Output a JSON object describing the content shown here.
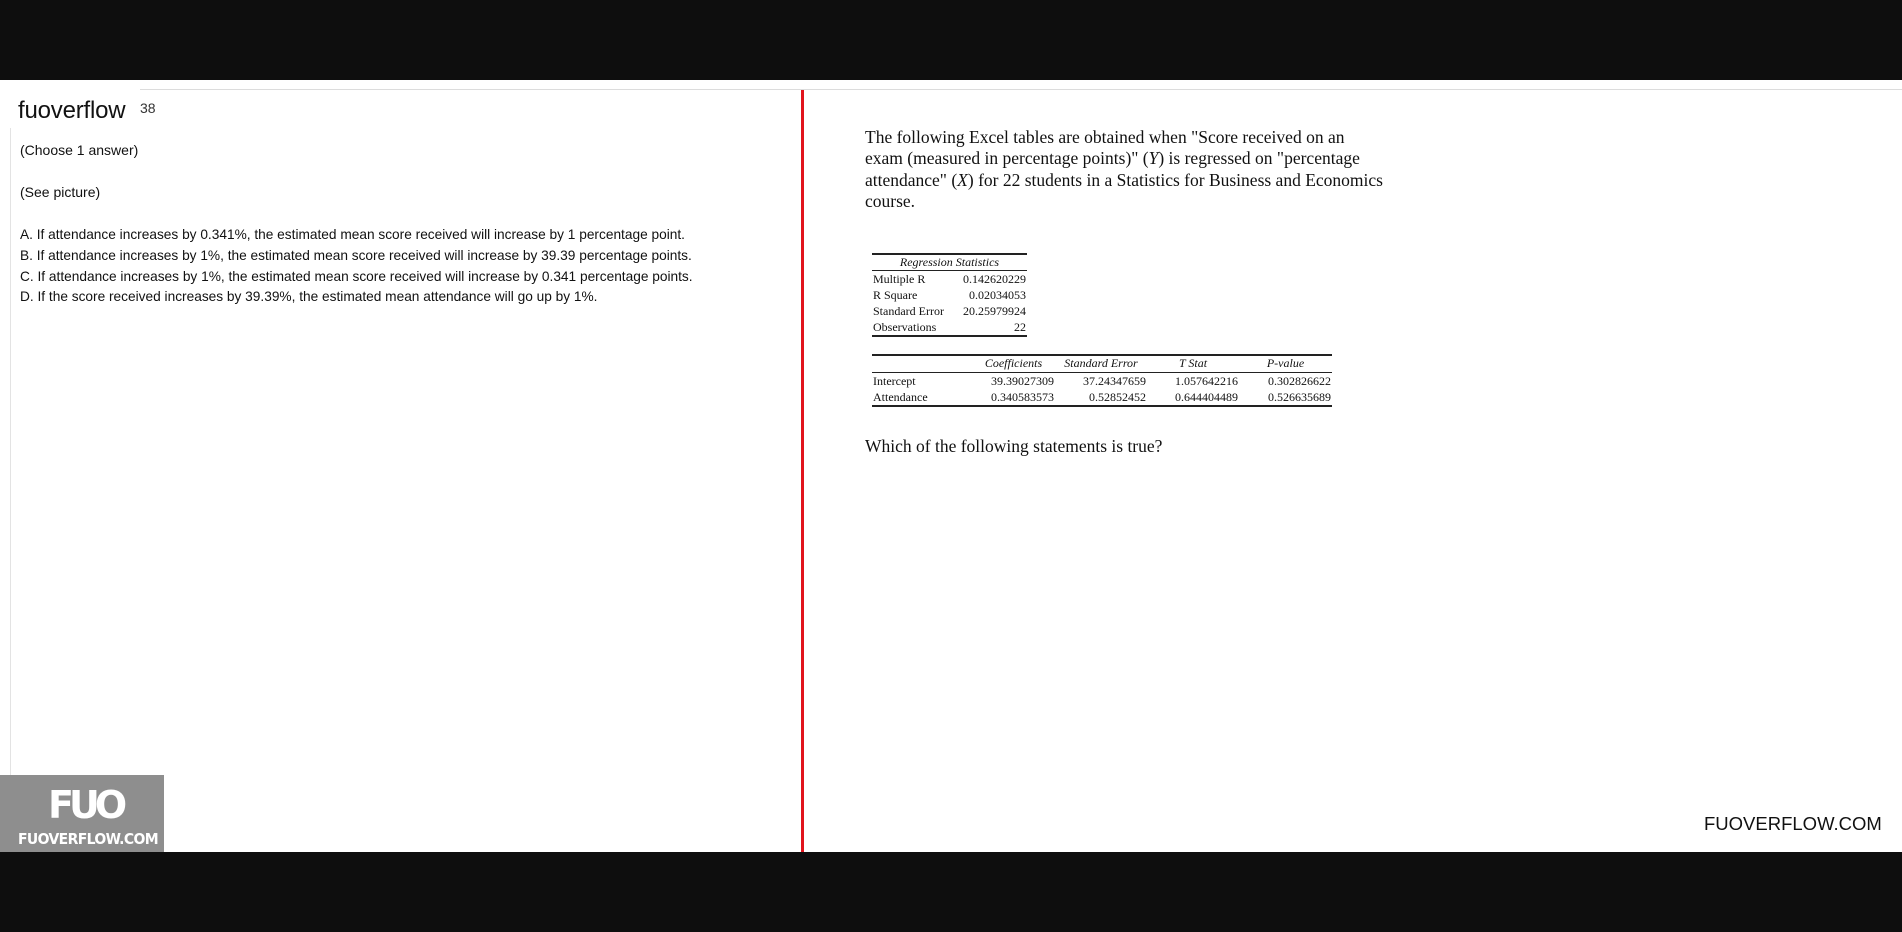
{
  "brand": {
    "name": "fuoverflow",
    "suffix": "38"
  },
  "question": {
    "instruction": "(Choose 1 answer)",
    "see_picture": "(See picture)",
    "options": [
      "A. If attendance increases by 0.341%, the estimated mean score received will increase by 1 percentage point.",
      "B. If attendance increases by 1%, the estimated mean score received will increase by 39.39 percentage points.",
      "C. If attendance increases by 1%, the estimated mean score received will increase by 0.341 percentage points.",
      "D. If the score received increases by 39.39%, the estimated mean attendance will go up by 1%."
    ]
  },
  "watermark": {
    "logo": "FUO",
    "text": "FUOVERFLOW.COM"
  },
  "picture": {
    "intro": {
      "p1": "The following Excel tables are obtained when \"Score received on an exam (measured in percentage points)\" (",
      "y_var": "Y",
      "p2": ") is regressed on \"percentage attendance\" (",
      "x_var": "X",
      "p3": ") for 22 students in a Statistics for Business and Economics course."
    },
    "regression_statistics": {
      "header": "Regression Statistics",
      "rows": [
        {
          "label": "Multiple R",
          "value": "0.142620229"
        },
        {
          "label": "R Square",
          "value": "0.02034053"
        },
        {
          "label": "Standard Error",
          "value": "20.25979924"
        },
        {
          "label": "Observations",
          "value": "22"
        }
      ]
    },
    "coefficients_table": {
      "headers": [
        "",
        "Coefficients",
        "Standard Error",
        "T Stat",
        "P-value"
      ],
      "rows": [
        {
          "label": "Intercept",
          "coef": "39.39027309",
          "se": "37.24347659",
          "t": "1.057642216",
          "p": "0.302826622"
        },
        {
          "label": "Attendance",
          "coef": "0.340583573",
          "se": "0.52852452",
          "t": "0.644404489",
          "p": "0.526635689"
        }
      ]
    },
    "prompt": "Which of the following statements is true?"
  },
  "footer_site": "FUOVERFLOW.COM"
}
